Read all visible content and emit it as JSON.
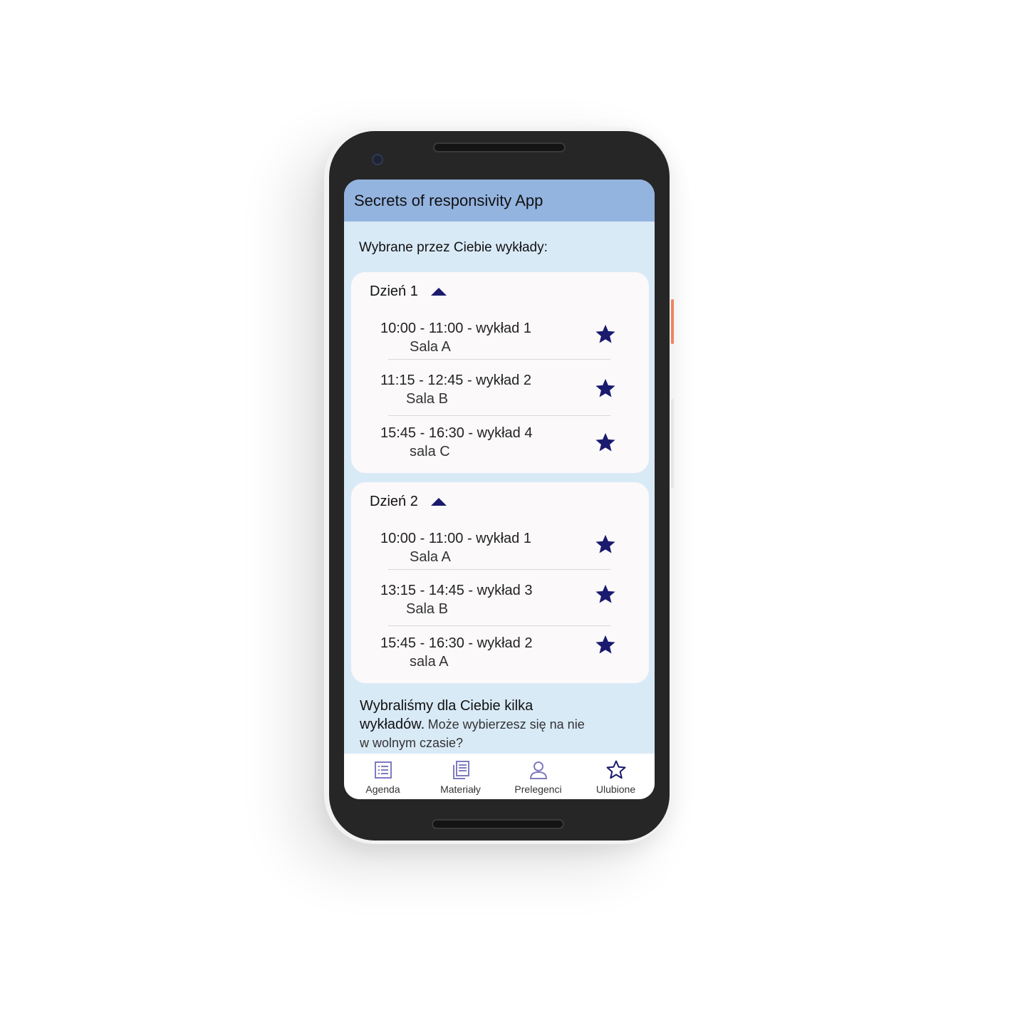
{
  "app": {
    "title": "Secrets of responsivity App"
  },
  "colors": {
    "accent": "#1a1a6e",
    "appbar": "#94b4e0",
    "screen_bg": "#d9eaf7",
    "card_bg": "#fbf9fa",
    "nav_icon": "#7f7bbf"
  },
  "main": {
    "heading": "Wybrane przez Ciebie wykłady:",
    "days": [
      {
        "title": "Dzień 1",
        "lectures": [
          {
            "title": "10:00 - 11:00 - wykład 1",
            "room": "Sala A"
          },
          {
            "title": "11:15 - 12:45 -  wykład 2",
            "room": "Sala B"
          },
          {
            "title": "15:45 - 16:30 - wykład 4",
            "room": "sala C"
          }
        ]
      },
      {
        "title": "Dzień 2",
        "lectures": [
          {
            "title": "10:00 - 11:00 - wykład 1",
            "room": "Sala A"
          },
          {
            "title": "13:15 - 14:45 -  wykład 3",
            "room": "Sala B"
          },
          {
            "title": "15:45 - 16:30 - wykład 2",
            "room": "sala A"
          }
        ]
      }
    ],
    "suggestion_bold": "Wybraliśmy dla Ciebie kilka wykładów.",
    "suggestion_light": "Może wybierzesz się na nie w wolnym czasie?"
  },
  "nav": {
    "items": [
      {
        "label": "Agenda",
        "icon": "list-icon"
      },
      {
        "label": "Materiały",
        "icon": "documents-icon"
      },
      {
        "label": "Prelegenci",
        "icon": "person-icon"
      },
      {
        "label": "Ulubione",
        "icon": "star-outline-icon"
      }
    ]
  }
}
